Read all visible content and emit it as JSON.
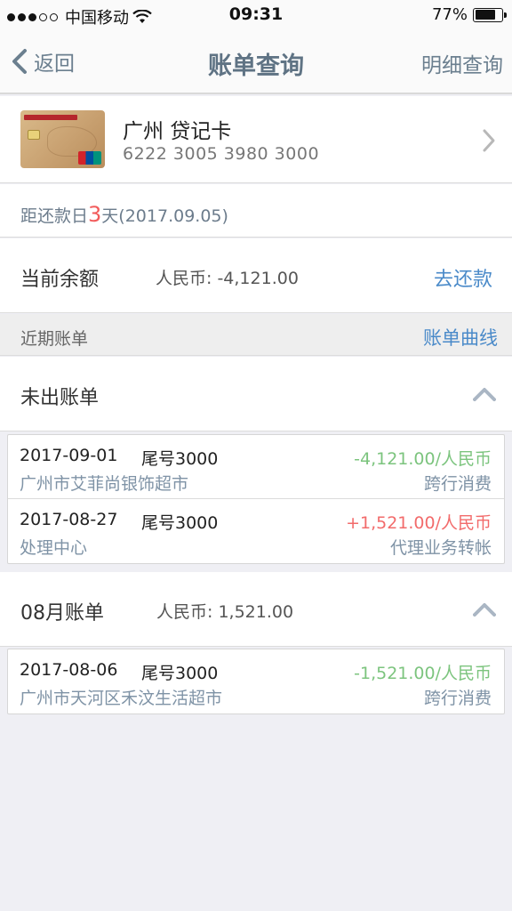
{
  "status_bar": {
    "carrier": "中国移动",
    "time": "09:31",
    "battery": "77%",
    "battery_level": 0.77
  },
  "nav": {
    "back_label": "返回",
    "title": "账单查询",
    "right_label": "明细查询"
  },
  "card": {
    "name": "广州 贷记卡",
    "number": "6222 3005 3980 3000"
  },
  "due": {
    "prefix": "距还款日",
    "days": "3",
    "suffix": "天(2017.09.05)"
  },
  "balance": {
    "label": "当前余额",
    "amount": "人民币: -4,121.00",
    "repay_label": "去还款"
  },
  "recent": {
    "title": "近期账单",
    "curve_label": "账单曲线"
  },
  "groups": [
    {
      "title": "未出账单",
      "amount": "",
      "transactions": [
        {
          "date": "2017-09-01",
          "tail": "尾号3000",
          "amount": "-4,121.00/人民币",
          "merchant": "广州市艾菲尚银饰超市",
          "type": "跨行消费"
        },
        {
          "date": "2017-08-27",
          "tail": "尾号3000",
          "amount": "+1,521.00/人民币",
          "merchant": "处理中心",
          "type": "代理业务转帐"
        }
      ]
    },
    {
      "title": "08月账单",
      "amount": "人民币: 1,521.00",
      "transactions": [
        {
          "date": "2017-08-06",
          "tail": "尾号3000",
          "amount": "-1,521.00/人民币",
          "merchant": "广州市天河区禾汶生活超市",
          "type": "跨行消费"
        }
      ]
    }
  ],
  "icons": {
    "back": "chevron-left-icon",
    "card_arrow": "chevron-right-icon",
    "collapse": "chevron-up-icon",
    "wifi": "wifi-icon",
    "battery": "battery-icon"
  },
  "colors": {
    "accent": "#4a8ac9",
    "nav_text": "#6b7f8f",
    "debit": "#7cc47e",
    "credit": "#f26b6b",
    "due_highlight": "#f25c5c"
  }
}
